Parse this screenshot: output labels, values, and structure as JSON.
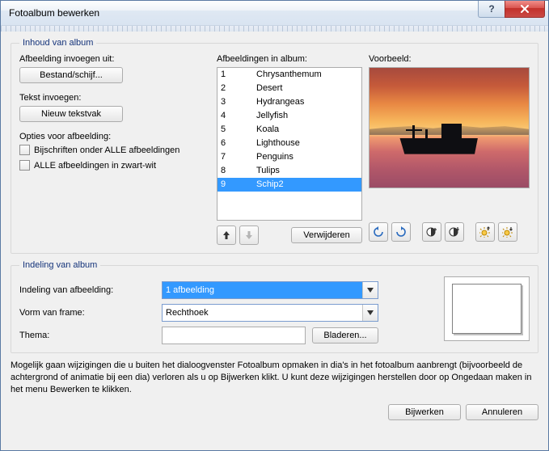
{
  "window": {
    "title": "Fotoalbum bewerken"
  },
  "groups": {
    "inhoud_legend": "Inhoud van album",
    "indeling_legend": "Indeling van album"
  },
  "insert_image": {
    "label": "Afbeelding invoegen uit:",
    "button": "Bestand/schijf..."
  },
  "insert_text": {
    "label": "Tekst invoegen:",
    "button": "Nieuw tekstvak"
  },
  "options": {
    "label": "Opties voor afbeelding:",
    "captions": "Bijschriften onder ALLE afbeeldingen",
    "bw": "ALLE afbeeldingen in zwart-wit"
  },
  "album_list": {
    "label": "Afbeeldingen in album:",
    "items": [
      {
        "n": "1",
        "name": "Chrysanthemum",
        "selected": false
      },
      {
        "n": "2",
        "name": "Desert",
        "selected": false
      },
      {
        "n": "3",
        "name": "Hydrangeas",
        "selected": false
      },
      {
        "n": "4",
        "name": "Jellyfish",
        "selected": false
      },
      {
        "n": "5",
        "name": "Koala",
        "selected": false
      },
      {
        "n": "6",
        "name": "Lighthouse",
        "selected": false
      },
      {
        "n": "7",
        "name": "Penguins",
        "selected": false
      },
      {
        "n": "8",
        "name": "Tulips",
        "selected": false
      },
      {
        "n": "9",
        "name": "Schip2",
        "selected": true
      }
    ],
    "remove_button": "Verwijderen"
  },
  "preview": {
    "label": "Voorbeeld:"
  },
  "layout": {
    "picture_layout_label": "Indeling van afbeelding:",
    "picture_layout_value": "1 afbeelding",
    "frame_shape_label": "Vorm van frame:",
    "frame_shape_value": "Rechthoek",
    "theme_label": "Thema:",
    "theme_value": "",
    "browse_button": "Bladeren..."
  },
  "note": "Mogelijk gaan wijzigingen die u buiten het dialoogvenster Fotoalbum opmaken in dia's in het fotoalbum aanbrengt (bijvoorbeeld de achtergrond of animatie bij een dia) verloren als u op Bijwerken klikt. U kunt deze wijzigingen herstellen door op Ongedaan maken in het menu Bewerken te klikken.",
  "buttons": {
    "update": "Bijwerken",
    "cancel": "Annuleren"
  },
  "icons": {
    "move_up": "move-up-icon",
    "move_down": "move-down-icon",
    "rotate_left": "rotate-left-icon",
    "rotate_right": "rotate-right-icon",
    "contrast_up": "contrast-up-icon",
    "contrast_down": "contrast-down-icon",
    "brightness_up": "brightness-up-icon",
    "brightness_down": "brightness-down-icon"
  }
}
